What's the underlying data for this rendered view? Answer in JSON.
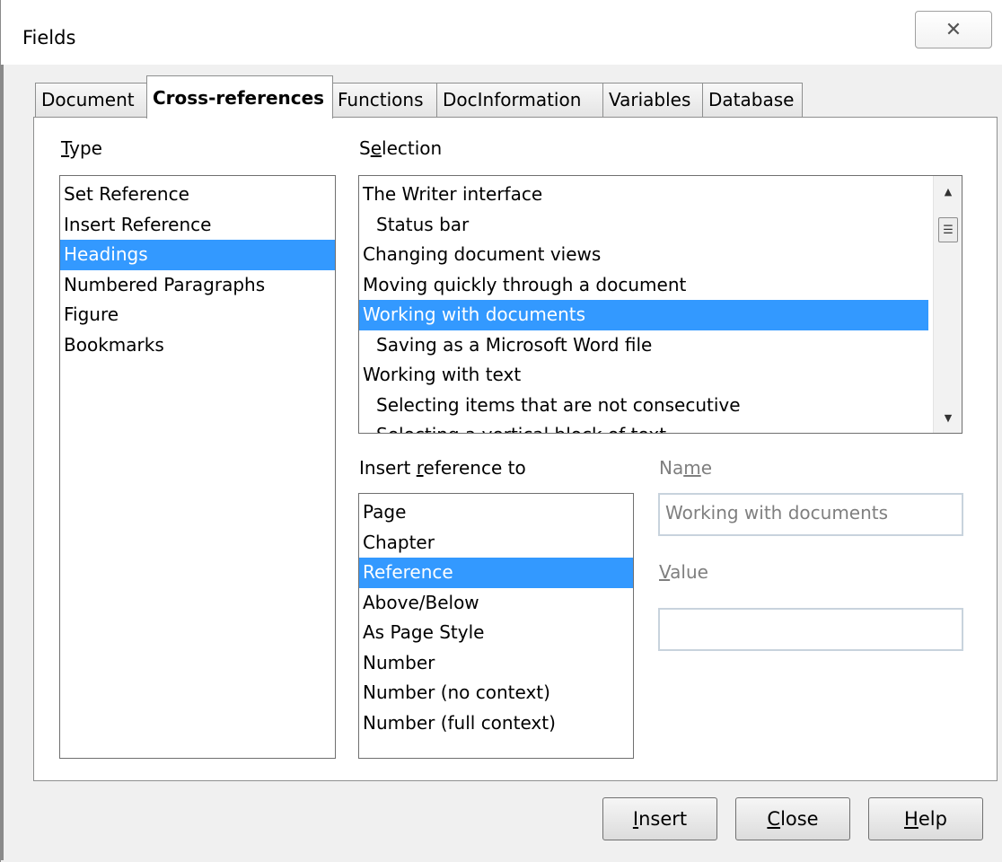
{
  "window": {
    "title": "Fields",
    "close_glyph": "✕"
  },
  "tabs": [
    {
      "label": "Document"
    },
    {
      "label": "Cross-references"
    },
    {
      "label": "Functions"
    },
    {
      "label": "DocInformation"
    },
    {
      "label": "Variables"
    },
    {
      "label": "Database"
    }
  ],
  "type": {
    "label_first": "T",
    "label_rest": "ype",
    "items": [
      "Set Reference",
      "Insert Reference",
      "Headings",
      "Numbered Paragraphs",
      "Figure",
      "Bookmarks"
    ],
    "selected": "Headings"
  },
  "selection": {
    "label_first": "S",
    "label_u": "e",
    "label_rest": "lection",
    "items": [
      "The Writer interface",
      "Status bar",
      "Changing document views",
      "Moving quickly through a document",
      "Working with documents",
      "Saving as a Microsoft Word file",
      "Working with text",
      "Selecting items that are not consecutive",
      "Selecting a vertical block of text"
    ],
    "selected": "Working with documents"
  },
  "insert_reference": {
    "label_first": "Insert ",
    "label_u": "r",
    "label_rest": "eference to",
    "items": [
      "Page",
      "Chapter",
      "Reference",
      "Above/Below",
      "As Page Style",
      "Number",
      "Number (no context)",
      "Number (full context)"
    ],
    "selected": "Reference"
  },
  "name_field": {
    "label_first": "Na",
    "label_u": "m",
    "label_rest": "e",
    "value": "Working with documents"
  },
  "value_field": {
    "label_u": "V",
    "label_rest": "alue",
    "value": ""
  },
  "buttons": {
    "insert_u": "I",
    "insert_rest": "nsert",
    "close_u": "C",
    "close_rest": "lose",
    "help_u": "H",
    "help_rest": "elp"
  },
  "colors": {
    "selection_bg": "#3399ff",
    "dialog_bg": "#f0f0f0"
  }
}
